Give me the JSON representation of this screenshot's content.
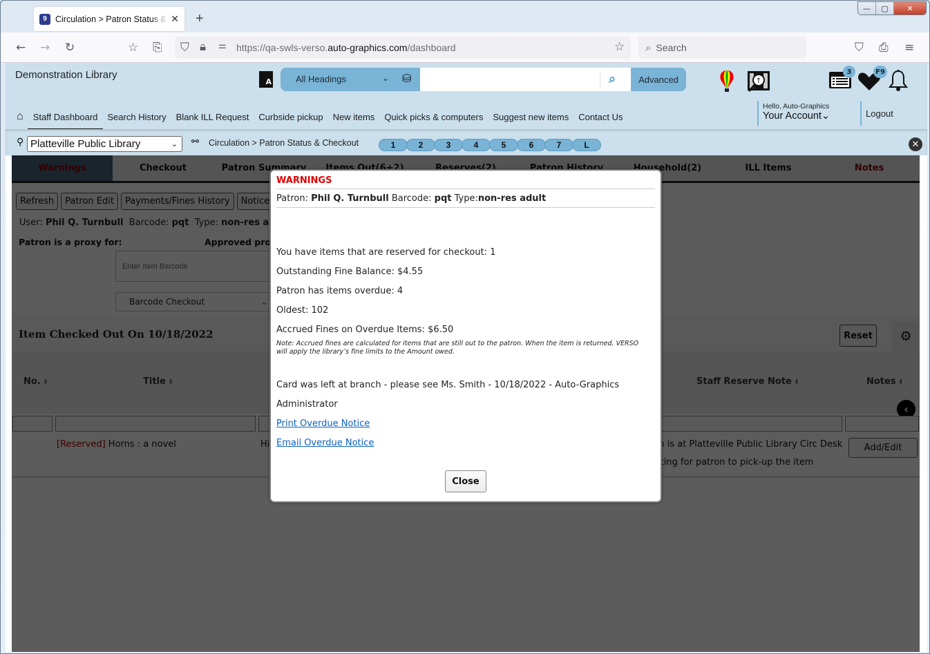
{
  "browser": {
    "tab_title": "Circulation > Patron Status & Checkout",
    "tab_favicon": "9",
    "new_tab": "+",
    "url_prefix": "https://qa-swls-verso.",
    "url_domain": "auto-graphics.com",
    "url_path": "/dashboard",
    "search_placeholder": "Search",
    "window_controls": {
      "minimize": "—",
      "maximize": "▢",
      "close": "✕"
    }
  },
  "header": {
    "library_name": "Demonstration Library",
    "search": {
      "scope": "All Headings",
      "query": "",
      "advanced_label": "Advanced"
    },
    "badges": {
      "list_count": "3",
      "favorites": "F9"
    },
    "account": {
      "greeting": "Hello, Auto-Graphics",
      "label": "Your Account⌄"
    },
    "logout_label": "Logout",
    "nav": [
      {
        "label": "Staff Dashboard",
        "active": true
      },
      {
        "label": "Search History"
      },
      {
        "label": "Blank ILL Request"
      },
      {
        "label": "Curbside pickup"
      },
      {
        "label": "New items"
      },
      {
        "label": "Quick picks & computers"
      },
      {
        "label": "Suggest new items"
      },
      {
        "label": "Contact Us"
      }
    ]
  },
  "subbar": {
    "location": "Platteville Public Library",
    "breadcrumb": "Circulation > Patron Status & Checkout",
    "pills": [
      "1",
      "2",
      "3",
      "4",
      "5",
      "6",
      "7",
      "L"
    ]
  },
  "circ": {
    "tabs": [
      {
        "label": "Warnings",
        "active": true
      },
      {
        "label": "Checkout"
      },
      {
        "label": "Patron Summary"
      },
      {
        "label": "Items Out(6+2)"
      },
      {
        "label": "Reserves(2)"
      },
      {
        "label": "Patron History"
      },
      {
        "label": "Household(2)"
      },
      {
        "label": "ILL Items"
      },
      {
        "label": "Notes",
        "red": true
      }
    ],
    "buttons": [
      "Refresh",
      "Patron Edit",
      "Payments/Fines History",
      "Notices"
    ],
    "user_label": "User:",
    "user_name": "Phil Q. Turnbull",
    "barcode_label": "Barcode:",
    "barcode": "pqt",
    "type_label": "Type:",
    "type": "non-res adult",
    "proxy_for_label": "Patron is a proxy for:",
    "approved_proxy_label": "Approved proxies:",
    "item_barcode_placeholder": "Enter Item Barcode",
    "checkout_mode": "Barcode Checkout",
    "section_title": "Item Checked Out On 10/18/2022",
    "reset_label": "Reset",
    "columns": [
      "No.",
      "Title",
      "Staff Reserve Note",
      "Notes"
    ],
    "rows": [
      {
        "status": "[Reserved]",
        "title": "Horns : a novel",
        "author_fragment": "Hi",
        "staff_note_line1": "Item is at Platteville Public Library Circ Desk",
        "staff_note_line2": "Waiting for patron to pick-up the item",
        "notes_button": "Add/Edit"
      }
    ]
  },
  "modal": {
    "title": "WARNINGS",
    "patron_label": "Patron:",
    "patron_name": "Phil Q. Turnbull",
    "barcode_label": "Barcode:",
    "barcode": "pqt",
    "type_label": "Type:",
    "type": "non-res adult",
    "lines": [
      "You have items that are reserved for checkout: 1",
      "Outstanding Fine Balance: $4.55",
      "Patron has items overdue: 4",
      "Oldest: 102",
      "Accrued Fines on Overdue Items: $6.50"
    ],
    "note": "Note: Accrued fines are calculated for items that are still out to the patron. When the item is returned, VERSO will apply the library’s fine limits to the Amount owed.",
    "message_line1": "Card was left at branch - please see Ms. Smith - 10/18/2022 - Auto-Graphics",
    "message_line2": "Administrator",
    "links": [
      "Print Overdue Notice",
      "Email Overdue Notice"
    ],
    "close_label": "Close"
  },
  "colors": {
    "accent": "#79b3d6",
    "header_bg": "#cbdfec",
    "warning_red": "#e00000",
    "link_blue": "#0b61c4"
  }
}
